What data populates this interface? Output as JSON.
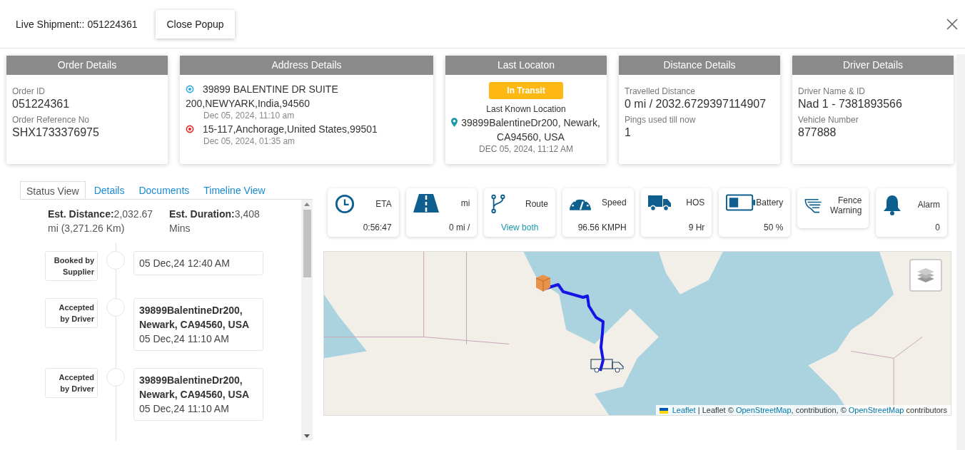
{
  "header": {
    "title": "Live Shipment:: 051224361",
    "close_popup_button": "Close Popup"
  },
  "cards": [
    {
      "kind": "fields",
      "title": "Order Details",
      "fields": [
        {
          "label": "Order ID",
          "value": "051224361"
        },
        {
          "label": "Order Reference No",
          "value": "SHX1733376975"
        }
      ]
    },
    {
      "kind": "addresses",
      "title": "Address Details",
      "stops": [
        {
          "color": "#2ea8e6",
          "address": "39899 BALENTINE DR SUITE 200,NEWYARK,India,94560",
          "time": "Dec 05, 2024, 11:10 am"
        },
        {
          "color": "#e52222",
          "address": "15-117,Anchorage,United States,99501",
          "time": "Dec 05, 2024, 01:35 am"
        }
      ]
    },
    {
      "kind": "location",
      "title": "Last Locaton",
      "status": "In Transit",
      "caption": "Last Known Location",
      "address": "39899BalentineDr200, Newark, CA94560, USA",
      "time": "DEC 05, 2024, 11:12 AM"
    },
    {
      "kind": "fields",
      "title": "Distance Details",
      "fields": [
        {
          "label": "Travelled Distance",
          "value": "0 mi / 2032.6729397114907"
        },
        {
          "label": "Pings used till now",
          "value": "1"
        }
      ]
    },
    {
      "kind": "fields",
      "title": "Driver Details",
      "fields": [
        {
          "label": "Driver Name & ID",
          "value": "Nad 1 - 7381893566"
        },
        {
          "label": "Vehicle Number",
          "value": "877888"
        }
      ]
    }
  ],
  "tabs": [
    {
      "label": "Status View",
      "selected": true
    },
    {
      "label": "Details",
      "selected": false
    },
    {
      "label": "Documents",
      "selected": false
    },
    {
      "label": "Timeline View",
      "selected": false
    }
  ],
  "summary": {
    "distance": "**Est. Distance:**2,032.67 mi (3,271.26 Km)",
    "duration": "**Est. Duration:**3,408 Mins"
  },
  "timeline": [
    {
      "status": "Booked by Supplier",
      "time": "05 Dec,24 12:40 AM"
    },
    {
      "status": "Accepted by Driver",
      "address": "39899BalentineDr200, Newark, CA94560, USA",
      "time": "05 Dec,24 11:10 AM"
    },
    {
      "status": "Accepted by Driver",
      "address": "39899BalentineDr200, Newark, CA94560, USA",
      "time": "05 Dec,24 11:10 AM"
    }
  ],
  "tiles": [
    {
      "label": "ETA",
      "value": "0:56:47"
    },
    {
      "label": "mi",
      "value": "0 mi /"
    },
    {
      "label": "Route",
      "value": "View both",
      "kind": "link"
    },
    {
      "label": "Speed",
      "value": "96.56 KMPH"
    },
    {
      "label": "HOS",
      "value": "9 Hr"
    },
    {
      "label": "Battery",
      "value": "50 %"
    },
    {
      "label": "Fence Warning"
    },
    {
      "label": "Alarm",
      "value": "0"
    }
  ],
  "map": {
    "attribution": [
      {
        "kind": "link",
        "text": "Leaflet"
      },
      {
        "kind": "text",
        "text": " | Leaflet © "
      },
      {
        "kind": "link",
        "text": "OpenStreetMap"
      },
      {
        "kind": "text",
        "text": ", contribution, © "
      },
      {
        "kind": "link",
        "text": "OpenStreetMap"
      },
      {
        "kind": "text",
        "text": " contributors"
      }
    ]
  }
}
